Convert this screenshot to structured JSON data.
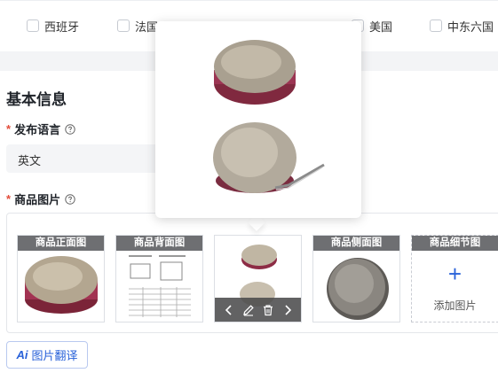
{
  "country_row": {
    "items": [
      {
        "label": "西班牙"
      },
      {
        "label": "法国"
      },
      {
        "label": ""
      },
      {
        "label": ""
      },
      {
        "label": "美国"
      },
      {
        "label": "中东六国"
      }
    ]
  },
  "basic_info": {
    "title": "基本信息",
    "publish_language": {
      "label": "发布语言",
      "value": "英文"
    },
    "product_images": {
      "label": "商品图片",
      "slots": [
        {
          "title": "商品正面图",
          "icon": "round-plate-photo"
        },
        {
          "title": "商品背面图",
          "icon": "spec-sheet-photo"
        },
        {
          "title": "",
          "icon": "two-plates-photo"
        },
        {
          "title": "商品侧面图",
          "icon": "plate-top-photo"
        },
        {
          "title": "商品细节图",
          "add_label": "添加图片"
        }
      ]
    },
    "translate_button": {
      "ai_mark": "Ai",
      "label": "图片翻译"
    }
  },
  "colors": {
    "required_star": "#e34d3b",
    "accent_blue": "#2962d9",
    "slot_title_bg": "#6e6f72"
  }
}
